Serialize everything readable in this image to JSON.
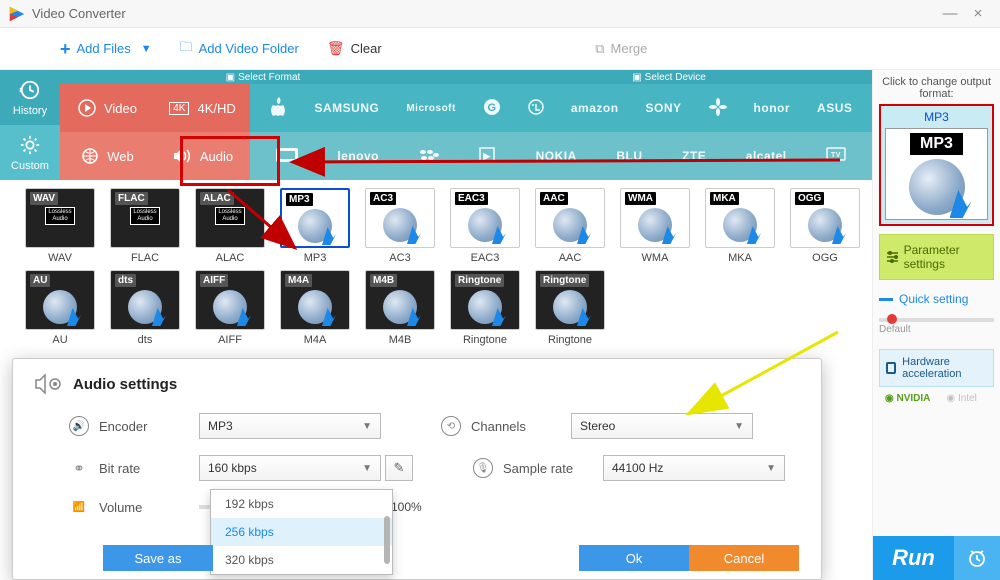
{
  "window": {
    "title": "Video Converter"
  },
  "toolbar": {
    "add_files": "Add Files",
    "add_folder": "Add Video Folder",
    "clear": "Clear",
    "merge": "Merge"
  },
  "sidebar": {
    "history": "History",
    "custom": "Custom"
  },
  "cat_header": {
    "format": "Select Format",
    "device": "Select Device"
  },
  "cats": {
    "video": "Video",
    "fourk": "4K/HD",
    "web": "Web",
    "audio": "Audio"
  },
  "brands_row1": [
    "",
    "SAMSUNG",
    "Microsoft",
    "G",
    "LG",
    "amazon",
    "SONY",
    "HUAWEI",
    "honor",
    "ASUS"
  ],
  "brands_row2": [
    "",
    "lenovo",
    "BB",
    "",
    "NOKIA",
    "BLU",
    "ZTE",
    "alcatel",
    "TV"
  ],
  "formats_row1": [
    "WAV",
    "FLAC",
    "ALAC",
    "MP3",
    "AC3",
    "EAC3",
    "AAC",
    "WMA",
    "MKA",
    "OGG"
  ],
  "formats_row2": [
    "AU",
    "dts",
    "AIFF",
    "M4A",
    "M4B",
    "Ringtone",
    "Ringtone"
  ],
  "selected_format_index": 3,
  "right": {
    "click_label": "Click to change output format:",
    "preview_title": "MP3",
    "preview_tag": "MP3",
    "param_settings": "Parameter settings",
    "quick": "Quick setting",
    "default": "Default",
    "hw": "Hardware acceleration",
    "nvidia": "NVIDIA",
    "intel": "Intel",
    "run": "Run"
  },
  "audio_panel": {
    "title": "Audio settings",
    "encoder_label": "Encoder",
    "encoder_value": "MP3",
    "bitrate_label": "Bit rate",
    "bitrate_value": "160 kbps",
    "volume_label": "Volume",
    "volume_pct": "100%",
    "channels_label": "Channels",
    "channels_value": "Stereo",
    "samplerate_label": "Sample rate",
    "samplerate_value": "44100 Hz",
    "bitrate_options": [
      "192 kbps",
      "256 kbps",
      "320 kbps"
    ],
    "bitrate_hl_index": 1,
    "save_as": "Save as",
    "ok": "Ok",
    "cancel": "Cancel"
  }
}
